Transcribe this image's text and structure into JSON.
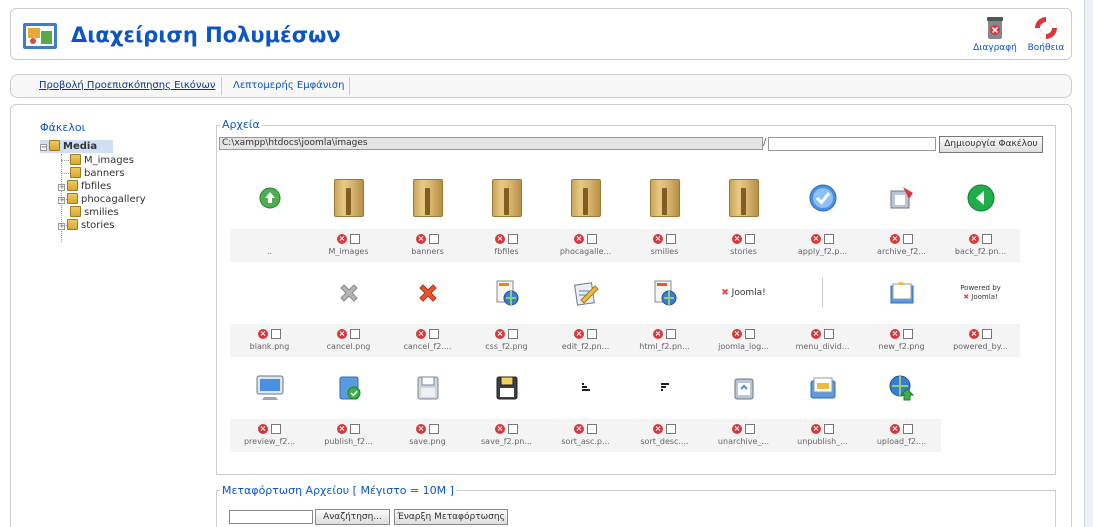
{
  "header": {
    "title": "Διαχείριση Πολυμέσων",
    "buttons": [
      {
        "label": "Διαγραφή",
        "icon": "trash-icon"
      },
      {
        "label": "Βοήθεια",
        "icon": "help-lifebuoy-icon"
      }
    ]
  },
  "submenu": {
    "items": [
      {
        "label": "Προβολή Προεπισκόπησης Εικόνων",
        "active": true
      },
      {
        "label": "Λεπτομερής Εμφάνιση",
        "active": false
      }
    ]
  },
  "tree": {
    "title": "Φάκελοι",
    "root": "Media",
    "children": [
      "M_images",
      "banners",
      "fbfiles",
      "phocagallery",
      "smilies",
      "stories"
    ]
  },
  "files": {
    "legend": "Αρχεία",
    "path": "C:\\xampp\\htdocs\\joomla\\images",
    "path_separator": "/",
    "new_folder_button": "Δημιουργία Φακέλου",
    "items": [
      {
        "name": "..",
        "icon": "folder-up-icon",
        "deletable": false
      },
      {
        "name": "M_images",
        "icon": "folder-icon",
        "deletable": true
      },
      {
        "name": "banners",
        "icon": "folder-icon",
        "deletable": true
      },
      {
        "name": "fbfiles",
        "icon": "folder-icon",
        "deletable": true
      },
      {
        "name": "phocagalle...",
        "icon": "folder-icon",
        "deletable": true
      },
      {
        "name": "smilies",
        "icon": "folder-icon",
        "deletable": true
      },
      {
        "name": "stories",
        "icon": "folder-icon",
        "deletable": true
      },
      {
        "name": "apply_f2.p...",
        "icon": "apply-check-icon",
        "deletable": true
      },
      {
        "name": "archive_f2...",
        "icon": "archive-icon",
        "deletable": true
      },
      {
        "name": "back_f2.pn...",
        "icon": "back-arrow-icon",
        "deletable": true
      },
      {
        "name": "blank.png",
        "icon": "blank-icon",
        "deletable": true
      },
      {
        "name": "cancel.png",
        "icon": "cancel-grey-icon",
        "deletable": true
      },
      {
        "name": "cancel_f2....",
        "icon": "cancel-red-icon",
        "deletable": true
      },
      {
        "name": "css_f2.png",
        "icon": "css-globe-icon",
        "deletable": true
      },
      {
        "name": "edit_f2.pn...",
        "icon": "edit-icon",
        "deletable": true
      },
      {
        "name": "html_f2.pn...",
        "icon": "html-globe-icon",
        "deletable": true
      },
      {
        "name": "joomla_log...",
        "icon": "joomla-logo-icon",
        "deletable": true
      },
      {
        "name": "menu_divid...",
        "icon": "menu-divider-icon",
        "deletable": true
      },
      {
        "name": "new_f2.png",
        "icon": "new-folder-icon",
        "deletable": true
      },
      {
        "name": "powered_by...",
        "icon": "powered-by-joomla-icon",
        "deletable": true
      },
      {
        "name": "preview_f2...",
        "icon": "preview-monitor-icon",
        "deletable": true
      },
      {
        "name": "publish_f2...",
        "icon": "publish-icon",
        "deletable": true
      },
      {
        "name": "save.png",
        "icon": "save-disk-icon",
        "deletable": true
      },
      {
        "name": "save_f2.pn...",
        "icon": "save-disk-dark-icon",
        "deletable": true
      },
      {
        "name": "sort_asc.p...",
        "icon": "sort-asc-icon",
        "deletable": true
      },
      {
        "name": "sort_desc....",
        "icon": "sort-desc-icon",
        "deletable": true
      },
      {
        "name": "unarchive_...",
        "icon": "unarchive-icon",
        "deletable": true
      },
      {
        "name": "unpublish_...",
        "icon": "unpublish-icon",
        "deletable": true
      },
      {
        "name": "upload_f2....",
        "icon": "upload-globe-icon",
        "deletable": true
      }
    ],
    "joomla_text": "Joomla!",
    "powered_text": "Powered by"
  },
  "upload": {
    "legend": "Μεταφόρτωση Αρχείου [ Μέγιστο = 10M ]",
    "browse_button": "Αναζήτηση...",
    "start_button": "Έναρξη Μεταφόρτωσης"
  },
  "colors": {
    "accent": "#0b55c4",
    "delete": "#d8383c",
    "selected_bg": "#cfe0f5"
  }
}
